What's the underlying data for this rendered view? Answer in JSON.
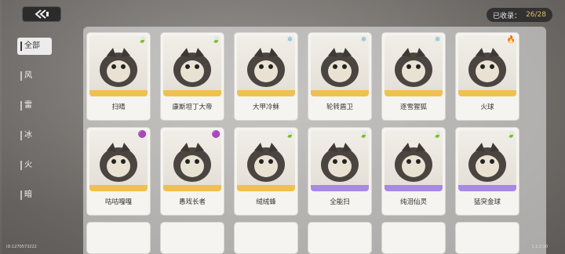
{
  "header": {
    "collected_label": "已收录：",
    "collected_count": "26/28"
  },
  "sidebar": {
    "tabs": [
      {
        "label": "全部",
        "active": true
      },
      {
        "label": "风",
        "active": false
      },
      {
        "label": "雷",
        "active": false
      },
      {
        "label": "冰",
        "active": false
      },
      {
        "label": "火",
        "active": false
      },
      {
        "label": "暗",
        "active": false
      }
    ]
  },
  "cards": [
    {
      "name": "扫晴",
      "element": "anemo-icon",
      "elem_color": "#3aa88f",
      "strip": "#f0c050"
    },
    {
      "name": "康斯坦丁大帝",
      "element": "anemo-icon",
      "elem_color": "#3aa88f",
      "strip": "#f0c050"
    },
    {
      "name": "大甲冷稣",
      "element": "cryo-icon",
      "elem_color": "#5ab8e0",
      "strip": "#f0c050"
    },
    {
      "name": "轮转盾卫",
      "element": "cryo-icon",
      "elem_color": "#5ab8e0",
      "strip": "#f0c050"
    },
    {
      "name": "逐雪猩狐",
      "element": "cryo-icon",
      "elem_color": "#5ab8e0",
      "strip": "#f0c050"
    },
    {
      "name": "火球",
      "element": "pyro-icon",
      "elem_color": "#e8643a",
      "strip": "#f0c050"
    },
    {
      "name": "咕咕嘎嘎",
      "element": "electro-icon",
      "elem_color": "#a266d8",
      "strip": "#f0c050"
    },
    {
      "name": "愚戏长者",
      "element": "electro-icon",
      "elem_color": "#a266d8",
      "strip": "#f0c050"
    },
    {
      "name": "绒绒蜂",
      "element": "anemo-icon",
      "elem_color": "#3aa88f",
      "strip": "#f0c050"
    },
    {
      "name": "全能扫",
      "element": "anemo-icon",
      "elem_color": "#3aa88f",
      "strip": "#a889e6"
    },
    {
      "name": "纯泪仙灵",
      "element": "anemo-icon",
      "elem_color": "#3aa88f",
      "strip": "#a889e6"
    },
    {
      "name": "猛突金球",
      "element": "anemo-icon",
      "elem_color": "#3aa88f",
      "strip": "#a889e6"
    }
  ],
  "footer": {
    "uid": "ID:1270573222",
    "version": "1.1.2.30"
  }
}
